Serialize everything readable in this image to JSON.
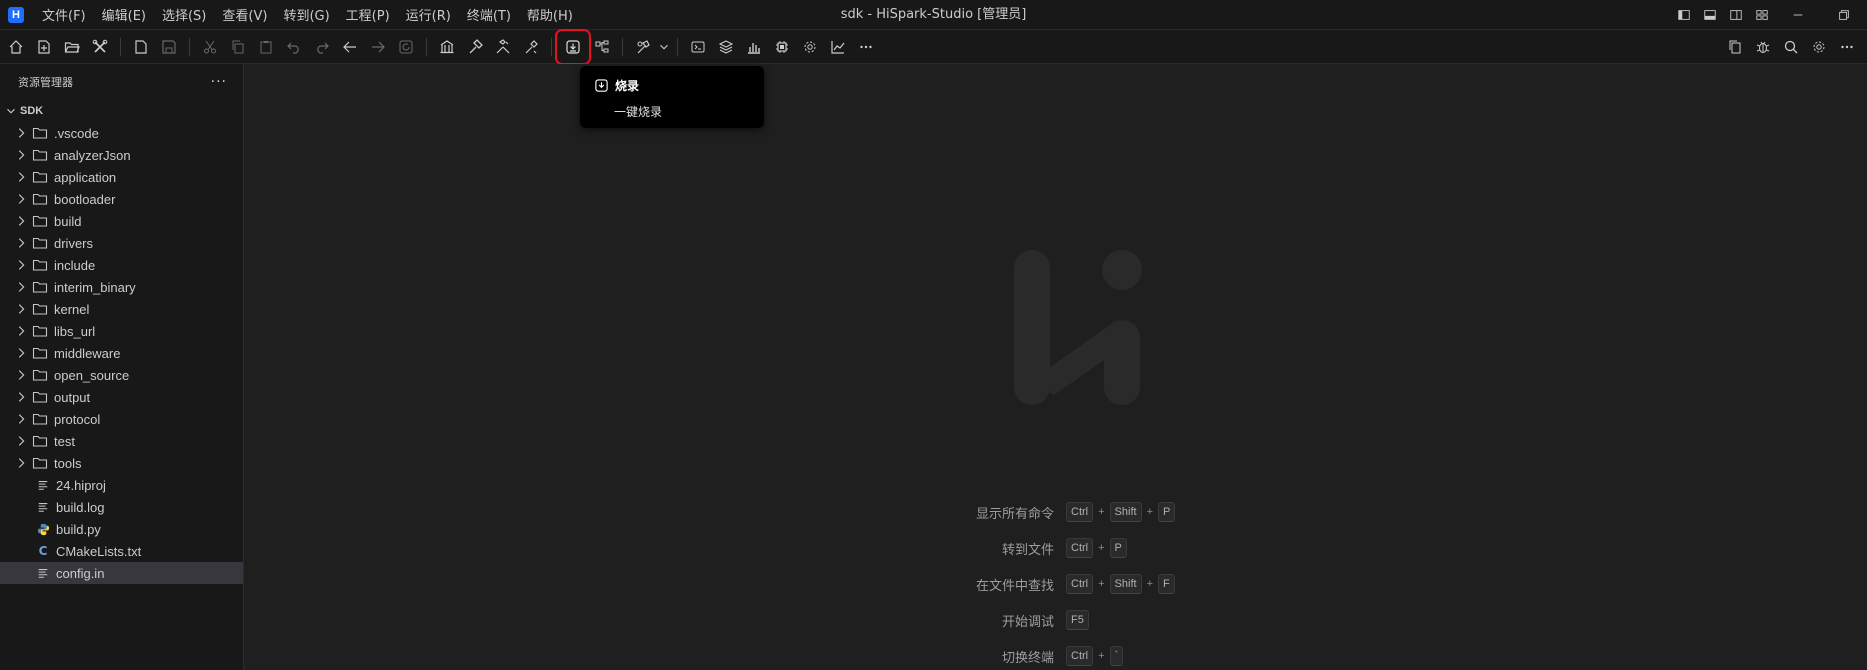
{
  "window": {
    "title": "sdk - HiSpark-Studio [管理员]",
    "logo_letter": "H"
  },
  "menu": [
    "文件(F)",
    "编辑(E)",
    "选择(S)",
    "查看(V)",
    "转到(G)",
    "工程(P)",
    "运行(R)",
    "终端(T)",
    "帮助(H)"
  ],
  "sidebar": {
    "title": "资源管理器",
    "more": "···",
    "root": "SDK",
    "folders": [
      ".vscode",
      "analyzerJson",
      "application",
      "bootloader",
      "build",
      "drivers",
      "include",
      "interim_binary",
      "kernel",
      "libs_url",
      "middleware",
      "open_source",
      "output",
      "protocol",
      "test",
      "tools"
    ],
    "files": [
      {
        "name": "24.hiproj",
        "icon": "lines-icon"
      },
      {
        "name": "build.log",
        "icon": "lines-icon"
      },
      {
        "name": "build.py",
        "icon": "python-icon"
      },
      {
        "name": "CMakeLists.txt",
        "icon": "cmake-icon"
      },
      {
        "name": "config.in",
        "icon": "lines-icon",
        "selected": true
      }
    ]
  },
  "tooltip": {
    "title": "烧录",
    "description": "一键烧录"
  },
  "shortcuts": [
    {
      "label": "显示所有命令",
      "keys": [
        "Ctrl",
        "Shift",
        "P"
      ]
    },
    {
      "label": "转到文件",
      "keys": [
        "Ctrl",
        "P"
      ]
    },
    {
      "label": "在文件中查找",
      "keys": [
        "Ctrl",
        "Shift",
        "F"
      ]
    },
    {
      "label": "开始调试",
      "keys": [
        "F5"
      ]
    },
    {
      "label": "切换终端",
      "keys": [
        "Ctrl",
        "`"
      ]
    }
  ],
  "colors": {
    "accent": "#1e6fff",
    "highlight_border": "#e81123",
    "selection": "#37373d"
  }
}
